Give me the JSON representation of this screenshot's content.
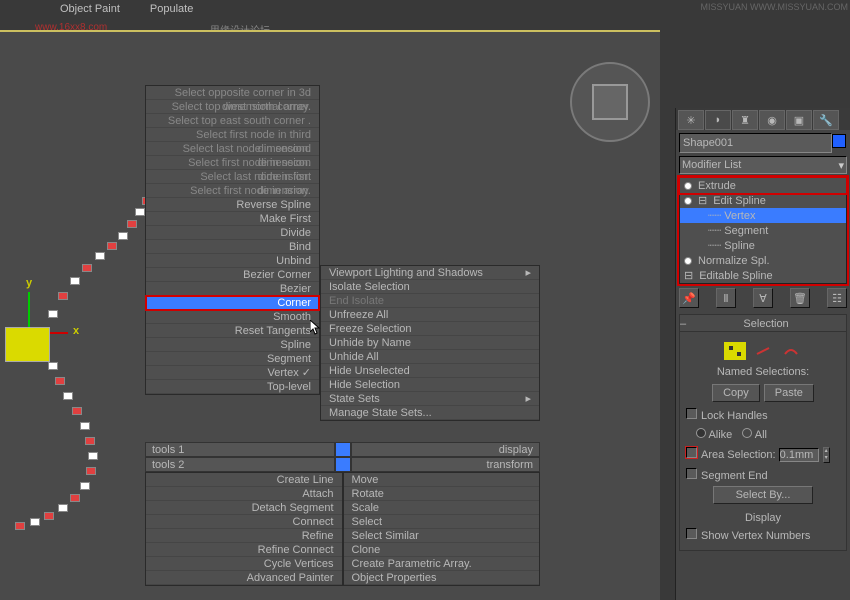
{
  "topbar": [
    "Object Paint",
    "Populate"
  ],
  "url_wm": "www.16xx8.com",
  "wm_top": "思缘设计论坛",
  "wm_tr": "MISSYUAN WWW.MISSYUAN.COM",
  "viewcube": "Top",
  "axis": {
    "y": "y",
    "x": "x"
  },
  "quad_left": {
    "header_items": [
      "Select opposite corner in 3d dimensional array.",
      "Select top west north corner.",
      "Select top east south corner .",
      "Select first node in third dimension.",
      "Select last node in second dimension.",
      "Select first node in secon dimension.",
      "Select last node in fisrt dimension.",
      "Select first node in array."
    ],
    "items": [
      {
        "label": "Reverse Spline"
      },
      {
        "label": "Make First"
      },
      {
        "label": "Divide"
      },
      {
        "label": "Bind"
      },
      {
        "label": "Unbind"
      },
      {
        "label": "Bezier Corner"
      },
      {
        "label": "Bezier"
      },
      {
        "label": "Corner",
        "hl": true,
        "red": true
      },
      {
        "label": "Smooth"
      },
      {
        "label": "Reset Tangents"
      },
      {
        "label": "Spline"
      },
      {
        "label": "Segment"
      },
      {
        "label": "Vertex",
        "check": true
      },
      {
        "label": "Top-level"
      }
    ],
    "lower": [
      {
        "label": "Create Line"
      },
      {
        "label": "Attach"
      },
      {
        "label": "Detach Segment"
      },
      {
        "label": "Connect"
      },
      {
        "label": "Refine"
      },
      {
        "label": "Refine Connect"
      },
      {
        "label": "Cycle Vertices"
      },
      {
        "label": "Advanced Painter"
      }
    ]
  },
  "quad_right": {
    "items": [
      {
        "label": "Viewport Lighting and Shadows",
        "arrow": true
      },
      {
        "label": "Isolate Selection"
      },
      {
        "label": "End Isolate",
        "dim": true
      },
      {
        "label": "Unfreeze All"
      },
      {
        "label": "Freeze Selection"
      },
      {
        "label": "Unhide by Name"
      },
      {
        "label": "Unhide All"
      },
      {
        "label": "Hide Unselected"
      },
      {
        "label": "Hide Selection"
      },
      {
        "label": "State Sets",
        "arrow": true
      },
      {
        "label": "Manage State Sets..."
      }
    ],
    "lower": [
      {
        "label": "Move"
      },
      {
        "label": "Rotate"
      },
      {
        "label": "Scale"
      },
      {
        "label": "Select"
      },
      {
        "label": "Select Similar"
      },
      {
        "label": "Clone"
      },
      {
        "label": "Create Parametric Array."
      },
      {
        "label": "Object Properties"
      }
    ]
  },
  "quad_titles": {
    "tl": "tools 1",
    "bl": "tools 2",
    "tr": "display",
    "br": "transform"
  },
  "cmd": {
    "object_name": "Shape001",
    "modlist": "Modifier List",
    "stack": [
      {
        "label": "Extrude",
        "bulb": true,
        "red": true
      },
      {
        "label": "Edit Spline",
        "bulb": true,
        "exp": true
      },
      {
        "label": "Vertex",
        "indent": 2,
        "sel": true
      },
      {
        "label": "Segment",
        "indent": 2
      },
      {
        "label": "Spline",
        "indent": 2
      },
      {
        "label": "Normalize Spl.",
        "bulb": true
      },
      {
        "label": "Editable Spline",
        "exp": true
      }
    ],
    "selection_hdr": "Selection",
    "named_sel": "Named Selections:",
    "copy": "Copy",
    "paste": "Paste",
    "lock": "Lock Handles",
    "alike": "Alike",
    "all": "All",
    "area": "Area Selection:",
    "area_val": "0.1mm",
    "segend": "Segment End",
    "selectby": "Select By...",
    "display": "Display",
    "showvnum": "Show Vertex Numbers"
  }
}
